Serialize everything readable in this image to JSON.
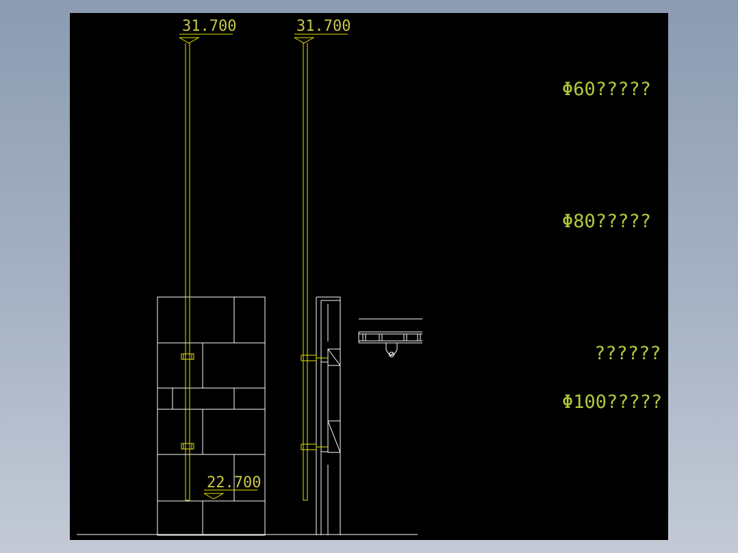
{
  "drawing": {
    "elevations": {
      "top_left": "31.700",
      "top_right": "31.700",
      "bottom": "22.700"
    },
    "notes": [
      "Φ60?????",
      "Φ80?????",
      "??????",
      "Φ100?????"
    ]
  },
  "colors": {
    "background": "#000000",
    "frame": "#9aa8bc",
    "rod": "#e6e600",
    "linework": "#ffffff",
    "text": "#b4c83c"
  }
}
